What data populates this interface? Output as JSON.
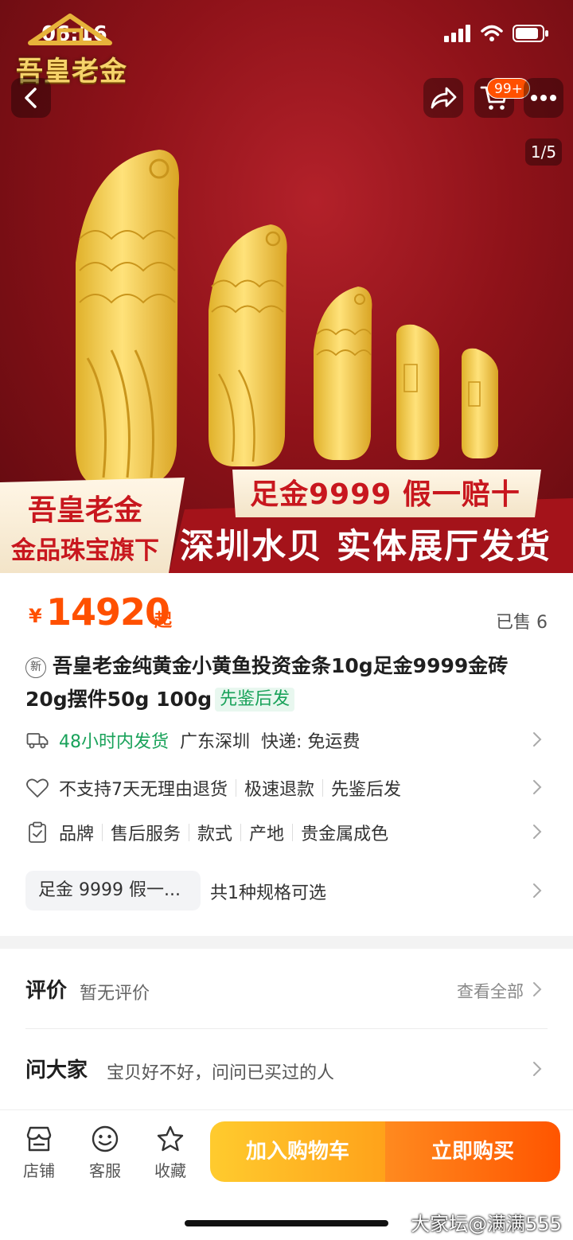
{
  "status_bar": {
    "time": "06:16"
  },
  "brand_logo": {
    "text": "吾皇老金"
  },
  "nav": {
    "cart_badge": "99+",
    "pager": "1/5"
  },
  "banner": {
    "left_title": "吾皇老金",
    "left_subtitle": "金品珠宝旗下",
    "mid_slogan": "足金9999  假一赔十",
    "bottom_slogan": "深圳水贝  实体展厅发货"
  },
  "product": {
    "currency": "¥",
    "price": "14920",
    "price_suffix": "起",
    "sold": "已售 6",
    "new_badge": "新",
    "title": "吾皇老金纯黄金小黄鱼投资金条10g足金9999金砖20g摆件50g 100g",
    "title_tag": "先鉴后发"
  },
  "shipping": {
    "time": "48小时内发货",
    "origin": "广东深圳",
    "express": "快递: 免运费"
  },
  "service": {
    "items": [
      "不支持7天无理由退货",
      "极速退款",
      "先鉴后发"
    ]
  },
  "params": {
    "items": [
      "品牌",
      "售后服务",
      "款式",
      "产地",
      "贵金属成色"
    ]
  },
  "spec": {
    "chip": "足金 9999 假一...",
    "text": "共1种规格可选"
  },
  "reviews": {
    "title": "评价",
    "empty": "暂无评价",
    "view_all": "查看全部"
  },
  "ask": {
    "title": "问大家",
    "hint": "宝贝好不好，问问已买过的人"
  },
  "bottom_bar": {
    "shop": "店铺",
    "service": "客服",
    "favorite": "收藏",
    "add_to_cart": "加入购物车",
    "buy_now": "立即购买"
  },
  "watermark": "大家坛@满满555",
  "colors": {
    "accent": "#ff5000",
    "green": "#19a25a",
    "gold": "#f2cc48",
    "banner_red": "#c8171e"
  }
}
